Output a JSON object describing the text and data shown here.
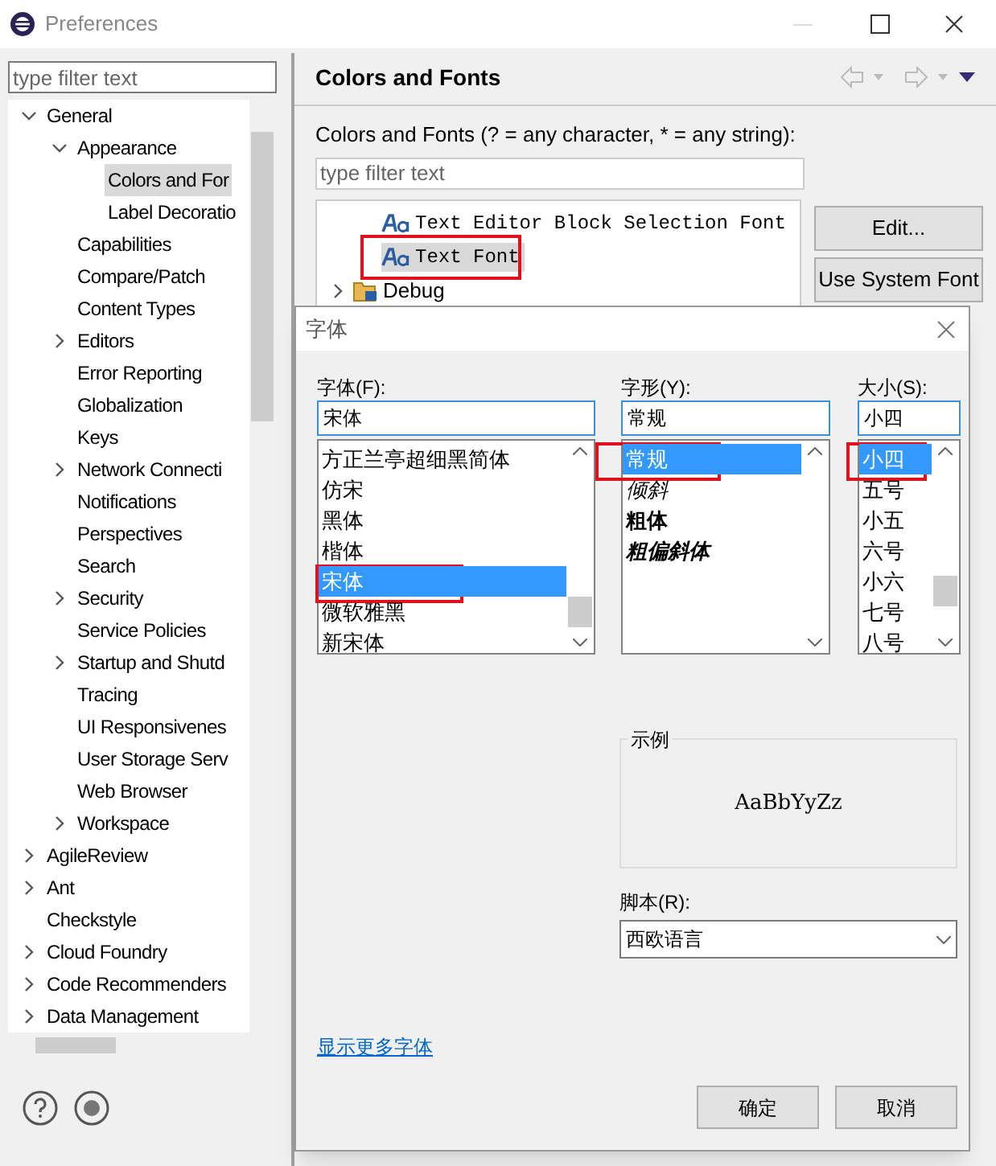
{
  "window": {
    "title": "Preferences"
  },
  "sidebar": {
    "filter": {
      "placeholder": "type filter text"
    },
    "items": [
      {
        "label": "General",
        "expanded": true,
        "selected": false,
        "children": [
          {
            "label": "Appearance",
            "expanded": true,
            "selected": false,
            "children": [
              {
                "label": "Colors and For",
                "selected": true
              },
              {
                "label": "Label Decoratio",
                "selected": false
              }
            ]
          },
          {
            "label": "Capabilities",
            "selected": false
          },
          {
            "label": "Compare/Patch",
            "selected": false
          },
          {
            "label": "Content Types",
            "selected": false
          },
          {
            "label": "Editors",
            "expanded": false,
            "selected": false
          },
          {
            "label": "Error Reporting",
            "selected": false
          },
          {
            "label": "Globalization",
            "selected": false
          },
          {
            "label": "Keys",
            "selected": false
          },
          {
            "label": "Network Connecti",
            "expanded": false,
            "selected": false
          },
          {
            "label": "Notifications",
            "selected": false
          },
          {
            "label": "Perspectives",
            "selected": false
          },
          {
            "label": "Search",
            "selected": false
          },
          {
            "label": "Security",
            "expanded": false,
            "selected": false
          },
          {
            "label": "Service Policies",
            "selected": false
          },
          {
            "label": "Startup and Shutd",
            "expanded": false,
            "selected": false
          },
          {
            "label": "Tracing",
            "selected": false
          },
          {
            "label": "UI Responsivenes",
            "selected": false
          },
          {
            "label": "User Storage Serv",
            "selected": false
          },
          {
            "label": "Web Browser",
            "selected": false
          },
          {
            "label": "Workspace",
            "expanded": false,
            "selected": false
          }
        ]
      },
      {
        "label": "AgileReview",
        "expanded": false,
        "selected": false
      },
      {
        "label": "Ant",
        "expanded": false,
        "selected": false
      },
      {
        "label": "Checkstyle",
        "selected": false
      },
      {
        "label": "Cloud Foundry",
        "expanded": false,
        "selected": false
      },
      {
        "label": "Code Recommenders",
        "expanded": false,
        "selected": false
      },
      {
        "label": "Data Management",
        "expanded": false,
        "selected": false
      }
    ]
  },
  "page": {
    "title": "Colors and Fonts",
    "description": "Colors and Fonts (? = any character, * = any string):",
    "filter": {
      "placeholder": "type filter text"
    },
    "tree": [
      {
        "kind": "font",
        "label": "Text Editor Block Selection Font",
        "selected": false,
        "highlighted": false
      },
      {
        "kind": "font",
        "label": "Text Font",
        "selected": true,
        "highlighted": true
      },
      {
        "kind": "category",
        "label": "Debug",
        "selected": false,
        "highlighted": false
      }
    ],
    "buttons": [
      "Edit...",
      "Use System Font"
    ]
  },
  "font_dialog": {
    "title": "字体",
    "font": {
      "label": "字体(F):",
      "value": "宋体",
      "items": [
        {
          "label": "方正兰亭超细黑简体",
          "selected": false,
          "highlighted": false
        },
        {
          "label": "仿宋",
          "selected": false,
          "highlighted": false
        },
        {
          "label": "黑体",
          "selected": false,
          "highlighted": false
        },
        {
          "label": "楷体",
          "selected": false,
          "highlighted": false
        },
        {
          "label": "宋体",
          "selected": true,
          "highlighted": true
        },
        {
          "label": "微软雅黑",
          "selected": false,
          "highlighted": false
        },
        {
          "label": "新宋体",
          "selected": false,
          "highlighted": false
        }
      ]
    },
    "style": {
      "label": "字形(Y):",
      "value": "常规",
      "items": [
        {
          "label": "常规",
          "kind": "regular",
          "selected": true,
          "highlighted": true
        },
        {
          "label": "倾斜",
          "kind": "italic",
          "selected": false,
          "highlighted": false
        },
        {
          "label": "粗体",
          "kind": "bold",
          "selected": false,
          "highlighted": false
        },
        {
          "label": "粗偏斜体",
          "kind": "bold_italic",
          "selected": false,
          "highlighted": false
        }
      ]
    },
    "size": {
      "label": "大小(S):",
      "value": "小四",
      "items": [
        {
          "label": "小四",
          "selected": true,
          "highlighted": true
        },
        {
          "label": "五号",
          "selected": false,
          "highlighted": false
        },
        {
          "label": "小五",
          "selected": false,
          "highlighted": false
        },
        {
          "label": "六号",
          "selected": false,
          "highlighted": false
        },
        {
          "label": "小六",
          "selected": false,
          "highlighted": false
        },
        {
          "label": "七号",
          "selected": false,
          "highlighted": false
        },
        {
          "label": "八号",
          "selected": false,
          "highlighted": false
        }
      ]
    },
    "sample": {
      "label": "示例",
      "text": "AaBbYyZz"
    },
    "script": {
      "label": "脚本(R):",
      "value": "西欧语言"
    },
    "link": "显示更多字体",
    "buttons": [
      "确定",
      "取消"
    ]
  }
}
